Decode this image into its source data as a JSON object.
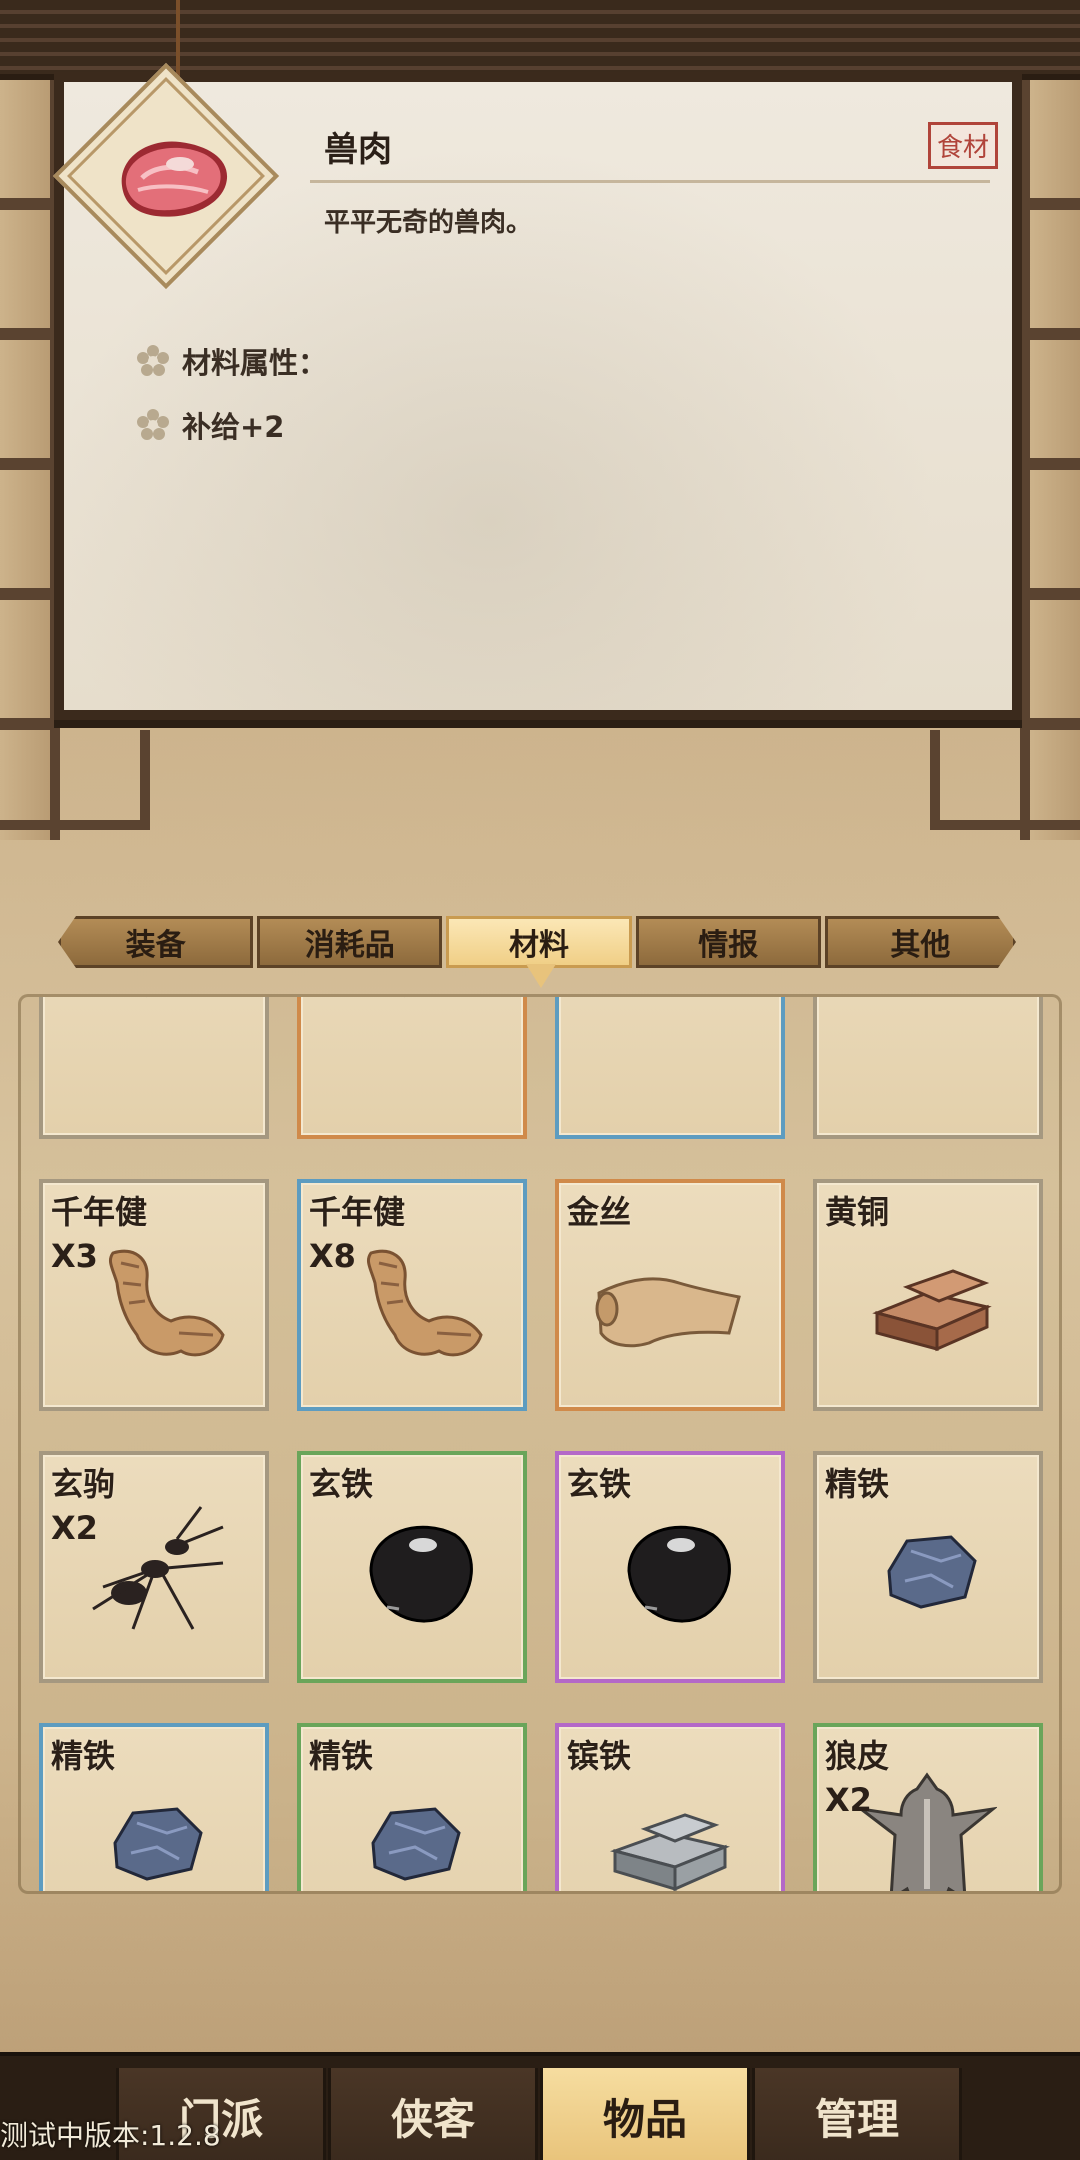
{
  "selected_item": {
    "name": "兽肉",
    "type": "食材",
    "description": "平平无奇的兽肉。",
    "attr_title": "材料属性：",
    "attr_value": "补给+2",
    "icon": "raw-meat-icon"
  },
  "tabs": [
    {
      "label": "装备",
      "active": false
    },
    {
      "label": "消耗品",
      "active": false
    },
    {
      "label": "材料",
      "active": true
    },
    {
      "label": "情报",
      "active": false
    },
    {
      "label": "其他",
      "active": false
    }
  ],
  "inventory": [
    {
      "name": "",
      "count": "",
      "rarity": "white",
      "icon": "blue-crystal-icon"
    },
    {
      "name": "",
      "count": "",
      "rarity": "orange",
      "icon": "blue-crystal-icon"
    },
    {
      "name": "",
      "count": "",
      "rarity": "blue",
      "icon": "bristle-fur-icon"
    },
    {
      "name": "",
      "count": "",
      "rarity": "white",
      "icon": "bristle-fur-icon"
    },
    {
      "name": "千年健",
      "count": "X3",
      "rarity": "white",
      "icon": "ginseng-root-icon"
    },
    {
      "name": "千年健",
      "count": "X8",
      "rarity": "blue",
      "icon": "ginseng-root-icon"
    },
    {
      "name": "金丝",
      "count": "",
      "rarity": "orange",
      "icon": "scroll-cloth-icon"
    },
    {
      "name": "黄铜",
      "count": "",
      "rarity": "white",
      "icon": "brass-ingot-icon"
    },
    {
      "name": "玄驹",
      "count": "X2",
      "rarity": "white",
      "icon": "ant-icon"
    },
    {
      "name": "玄铁",
      "count": "",
      "rarity": "green",
      "icon": "black-stone-icon"
    },
    {
      "name": "玄铁",
      "count": "",
      "rarity": "purple",
      "icon": "black-stone-icon"
    },
    {
      "name": "精铁",
      "count": "",
      "rarity": "white",
      "icon": "iron-ore-icon"
    },
    {
      "name": "精铁",
      "count": "",
      "rarity": "blue",
      "icon": "iron-ore-icon"
    },
    {
      "name": "精铁",
      "count": "",
      "rarity": "green",
      "icon": "iron-ore-icon"
    },
    {
      "name": "镔铁",
      "count": "",
      "rarity": "purple",
      "icon": "steel-ingot-icon"
    },
    {
      "name": "狼皮",
      "count": "X2",
      "rarity": "green",
      "icon": "wolf-pelt-icon"
    }
  ],
  "bottom_nav": [
    {
      "label": "门派",
      "active": false
    },
    {
      "label": "侠客",
      "active": false
    },
    {
      "label": "物品",
      "active": true
    },
    {
      "label": "管理",
      "active": false
    }
  ],
  "version_text": "测试中版本:1.2.8"
}
